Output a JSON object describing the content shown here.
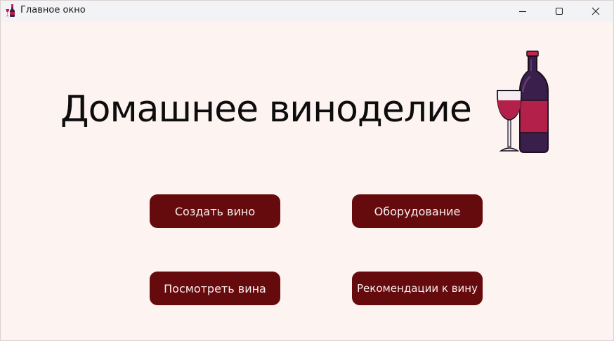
{
  "window": {
    "title": "Главное окно",
    "app_icon": "wine-bottle-icon",
    "controls": [
      "minimize-icon",
      "maximize-icon",
      "close-icon"
    ]
  },
  "main": {
    "heading": "Домашнее виноделие",
    "image": "wine-bottle-and-glass-icon",
    "buttons": {
      "create_wine": "Создать вино",
      "equipment": "Оборудование",
      "view_wines": "Посмотреть вина",
      "recommendations": "Рекомендации к вину"
    }
  },
  "colors": {
    "background": "#fdf3f1",
    "titlebar": "#f3f3f6",
    "button": "#660b0d",
    "button_text": "#f7eeee",
    "heading_text": "#0d0d0d",
    "wine": "#b3204a",
    "bottle": "#3a1f4d"
  }
}
